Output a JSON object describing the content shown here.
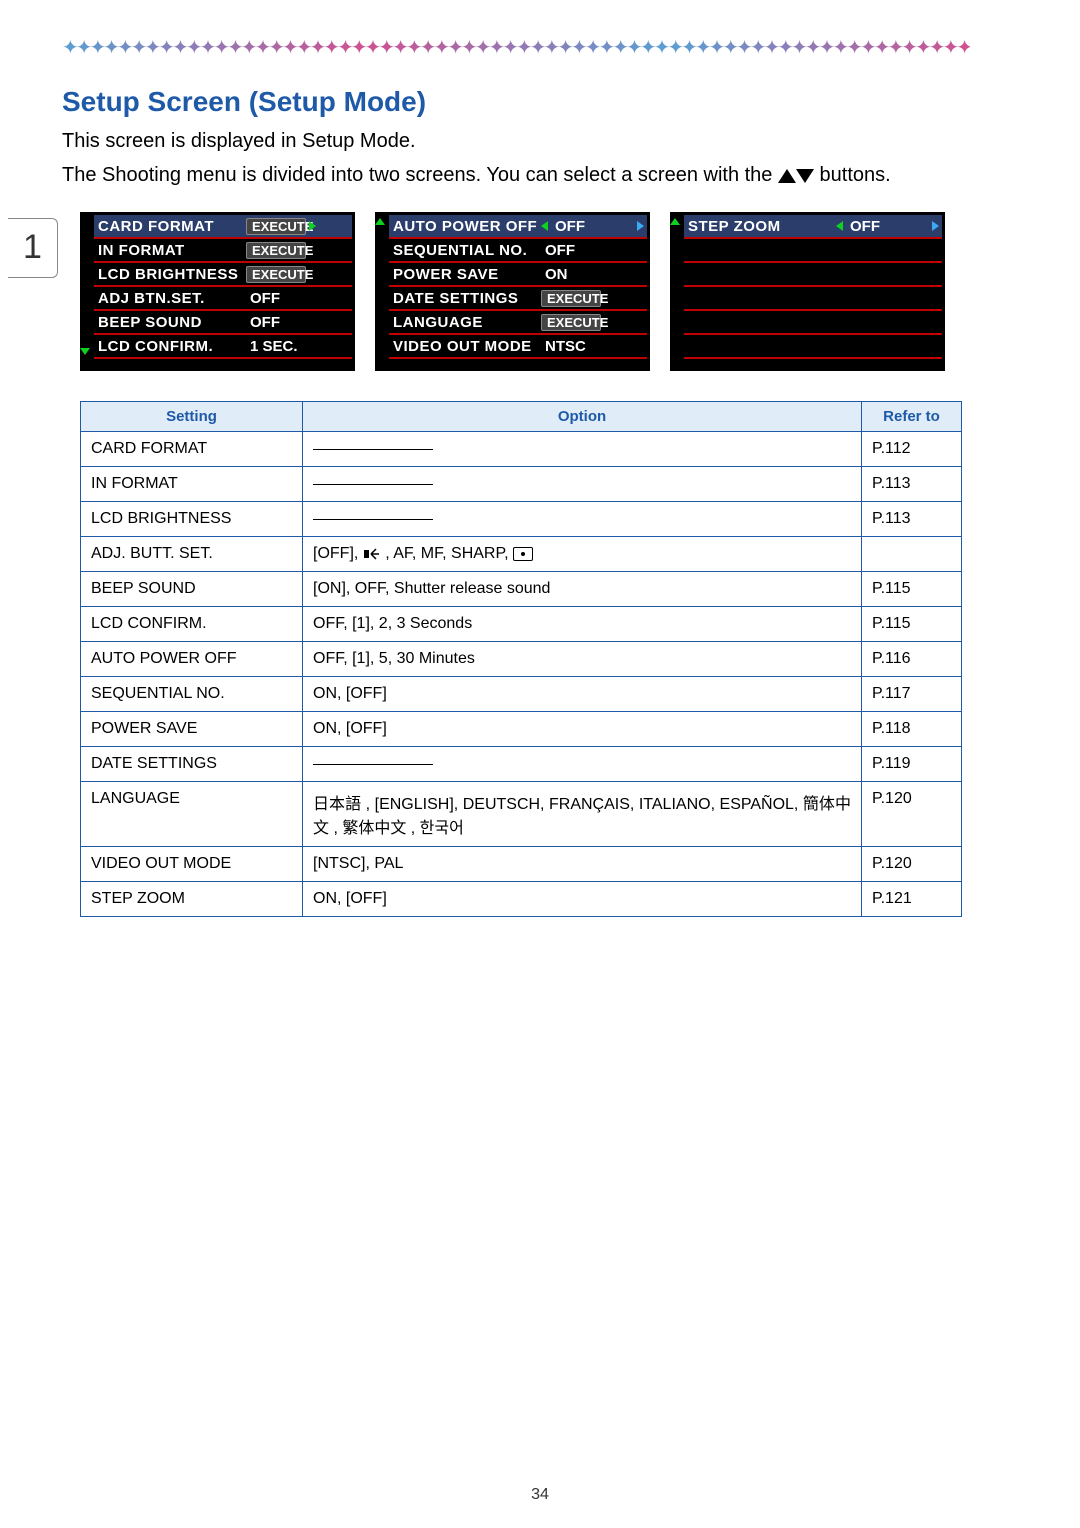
{
  "page_number": "34",
  "tab_number": "1",
  "heading": "Setup Screen (Setup Mode)",
  "intro_lines": {
    "l1": "This screen is displayed in Setup Mode.",
    "l2a": "The Shooting menu is divided into two screens. You can select a screen with the ",
    "l2b": " buttons."
  },
  "screens": [
    {
      "rows": [
        {
          "label": "CARD FORMAT",
          "value": "EXECUTE",
          "btn": true,
          "selected": true,
          "right_arrow": true
        },
        {
          "label": "IN FORMAT",
          "value": "EXECUTE",
          "btn": true
        },
        {
          "label": "LCD BRIGHTNESS",
          "value": "EXECUTE",
          "btn": true
        },
        {
          "label": "ADJ BTN.SET.",
          "value": "OFF"
        },
        {
          "label": "BEEP SOUND",
          "value": "OFF"
        },
        {
          "label": "LCD CONFIRM.",
          "value": "1 SEC."
        }
      ],
      "scroll_down": true
    },
    {
      "rows": [
        {
          "label": "AUTO POWER OFF",
          "value": "OFF",
          "selected": true,
          "left_arrow": true,
          "right_arrow_blue": true
        },
        {
          "label": "SEQUENTIAL NO.",
          "value": "OFF"
        },
        {
          "label": "POWER SAVE",
          "value": "ON"
        },
        {
          "label": "DATE SETTINGS",
          "value": "EXECUTE",
          "btn": true
        },
        {
          "label": "LANGUAGE",
          "value": "EXECUTE",
          "btn": true
        },
        {
          "label": "VIDEO OUT MODE",
          "value": "NTSC"
        }
      ],
      "scroll_up": true
    },
    {
      "rows": [
        {
          "label": "STEP ZOOM",
          "value": "OFF",
          "selected": true,
          "left_arrow": true,
          "right_arrow_blue": true
        },
        {
          "label": "",
          "value": ""
        },
        {
          "label": "",
          "value": ""
        },
        {
          "label": "",
          "value": ""
        },
        {
          "label": "",
          "value": ""
        },
        {
          "label": "",
          "value": ""
        }
      ],
      "scroll_up": true
    }
  ],
  "table": {
    "headers": {
      "c1": "Setting",
      "c2": "Option",
      "c3": "Refer to"
    },
    "rows": [
      {
        "setting": "CARD FORMAT",
        "option": "__line__",
        "ref": "P.112"
      },
      {
        "setting": "IN FORMAT",
        "option": "__line__",
        "ref": "P.113"
      },
      {
        "setting": "LCD BRIGHTNESS",
        "option": "__line__",
        "ref": "P.113"
      },
      {
        "setting": "ADJ. BUTT. SET.",
        "option": "[OFF], __wb__ , AF, MF, SHARP, __spot__",
        "ref": ""
      },
      {
        "setting": "BEEP SOUND",
        "option": "[ON], OFF, Shutter release sound",
        "ref": "P.115"
      },
      {
        "setting": "LCD CONFIRM.",
        "option": "OFF, [1], 2, 3 Seconds",
        "ref": "P.115"
      },
      {
        "setting": "AUTO POWER OFF",
        "option": "OFF, [1], 5, 30 Minutes",
        "ref": "P.116"
      },
      {
        "setting": "SEQUENTIAL NO.",
        "option": "ON, [OFF]",
        "ref": "P.117"
      },
      {
        "setting": "POWER SAVE",
        "option": "ON, [OFF]",
        "ref": "P.118"
      },
      {
        "setting": "DATE SETTINGS",
        "option": "__line__",
        "ref": "P.119"
      },
      {
        "setting": "LANGUAGE",
        "option": "日本語 , [ENGLISH], DEUTSCH, FRANÇAIS, ITALIANO, ESPAÑOL, 簡体中文 , 繁体中文 , 한국어",
        "ref": "P.120"
      },
      {
        "setting": "VIDEO OUT MODE",
        "option": "[NTSC], PAL",
        "ref": "P.120"
      },
      {
        "setting": "STEP ZOOM",
        "option": "ON, [OFF]",
        "ref": "P.121"
      }
    ]
  }
}
